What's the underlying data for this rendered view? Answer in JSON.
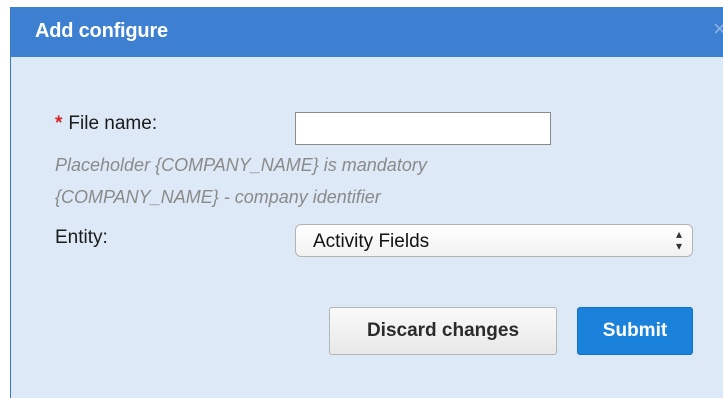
{
  "dialog": {
    "title": "Add configure",
    "close_glyph": "×"
  },
  "form": {
    "required_marker": "*",
    "file_name_label": "File name:",
    "file_name_value": "",
    "hint_line1": "Placeholder {COMPANY_NAME} is mandatory",
    "hint_line2": "{COMPANY_NAME} - company identifier",
    "entity_label": "Entity:",
    "entity_selected": "Activity Fields"
  },
  "actions": {
    "discard_label": "Discard changes",
    "submit_label": "Submit"
  },
  "colors": {
    "titlebar": "#3d7fd0",
    "dialog_body": "#dde9f6",
    "submit_button": "#1b82dc",
    "required_star": "#d42525",
    "hint_text": "#8a8a8a"
  },
  "icons": {
    "close": "close-icon",
    "select_arrows": "select-arrows-icon"
  }
}
